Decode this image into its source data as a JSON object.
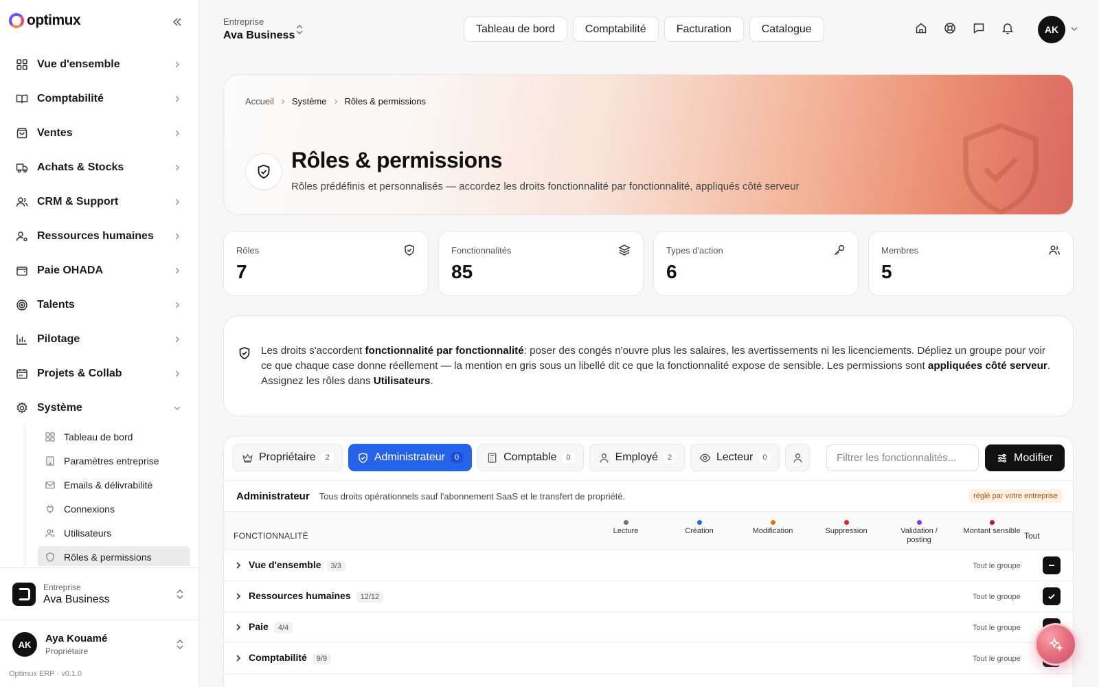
{
  "brand": {
    "name": "optimux"
  },
  "sidebar": {
    "items": [
      {
        "label": "Vue d'ensemble",
        "icon": "grid-icon"
      },
      {
        "label": "Comptabilité",
        "icon": "book-icon"
      },
      {
        "label": "Ventes",
        "icon": "shopping-bag-icon"
      },
      {
        "label": "Achats & Stocks",
        "icon": "truck-icon"
      },
      {
        "label": "CRM & Support",
        "icon": "users-icon"
      },
      {
        "label": "Ressources humaines",
        "icon": "user-cog-icon"
      },
      {
        "label": "Paie OHADA",
        "icon": "wallet-icon"
      },
      {
        "label": "Talents",
        "icon": "target-icon"
      },
      {
        "label": "Pilotage",
        "icon": "bar-chart-icon"
      },
      {
        "label": "Projets & Collab",
        "icon": "calendar-icon"
      },
      {
        "label": "Système",
        "icon": "gear-icon"
      }
    ],
    "system_sub": [
      {
        "label": "Tableau de bord",
        "icon": "grid-icon"
      },
      {
        "label": "Paramètres entreprise",
        "icon": "building-icon"
      },
      {
        "label": "Emails & délivrabilité",
        "icon": "mail-icon"
      },
      {
        "label": "Connexions",
        "icon": "plug-icon"
      },
      {
        "label": "Utilisateurs",
        "icon": "users-icon"
      },
      {
        "label": "Rôles & permissions",
        "icon": "shield-icon"
      }
    ],
    "company": {
      "label": "Entreprise",
      "name": "Ava Business"
    },
    "user": {
      "initials": "AK",
      "name": "Aya Kouamé",
      "role": "Propriétaire"
    },
    "version": "Optimux ERP · v0.1.0"
  },
  "topbar": {
    "entreprise_label": "Entreprise",
    "entreprise_name": "Ava Business",
    "tabs": [
      "Tableau de bord",
      "Comptabilité",
      "Facturation",
      "Catalogue"
    ],
    "icons": [
      "home-icon",
      "help-icon",
      "message-icon",
      "bell-icon"
    ],
    "avatar": "AK"
  },
  "hero": {
    "breadcrumb": [
      "Accueil",
      "Système",
      "Rôles & permissions"
    ],
    "title": "Rôles & permissions",
    "subtitle": "Rôles prédéfinis et personnalisés — accordez les droits fonctionnalité par fonctionnalité, appliqués côté serveur"
  },
  "stats": [
    {
      "label": "Rôles",
      "value": "7",
      "icon": "shield-icon"
    },
    {
      "label": "Fonctionnalités",
      "value": "85",
      "icon": "layers-icon"
    },
    {
      "label": "Types d'action",
      "value": "6",
      "icon": "key-icon"
    },
    {
      "label": "Membres",
      "value": "5",
      "icon": "users-icon"
    }
  ],
  "info": {
    "t1": "Les droits s'accordent ",
    "b1": "fonctionnalité par fonctionnalité",
    "t2": ": poser des congés n'ouvre plus les salaires, les avertissements ni les licenciements. Dépliez un groupe pour voir ce que chaque case donne réellement — la mention en gris sous un libellé dit ce que la fonctionnalité expose de sensible. Les permissions sont ",
    "b2": "appliquées côté serveur",
    "t3": ". Assignez les rôles dans ",
    "b3": "Utilisateurs",
    "t4": "."
  },
  "roles": {
    "tabs": [
      {
        "label": "Propriétaire",
        "count": "2",
        "icon": "crown-icon"
      },
      {
        "label": "Administrateur",
        "count": "0",
        "icon": "shield-icon"
      },
      {
        "label": "Comptable",
        "count": "0",
        "icon": "calculator-icon"
      },
      {
        "label": "Employé",
        "count": "2",
        "icon": "user-icon"
      },
      {
        "label": "Lecteur",
        "count": "0",
        "icon": "eye-icon"
      }
    ],
    "filter_placeholder": "Filtrer les fonctionnalités...",
    "modify_label": "Modifier",
    "selected": {
      "name": "Administrateur",
      "description": "Tous droits opérationnels sauf l'abonnement SaaS et le transfert de propriété.",
      "badge": "réglé par votre entreprise"
    }
  },
  "table": {
    "feature_header": "FONCTIONNALITÉ",
    "all_header": "Tout",
    "columns": [
      {
        "label1": "Lecture",
        "label2": "",
        "color": "#6b7280"
      },
      {
        "label1": "Création",
        "label2": "",
        "color": "#2563eb"
      },
      {
        "label1": "Modification",
        "label2": "",
        "color": "#d97706"
      },
      {
        "label1": "Suppression",
        "label2": "",
        "color": "#dc2626"
      },
      {
        "label1": "Validation /",
        "label2": "posting",
        "color": "#7c3aed"
      },
      {
        "label1": "Montant sensible",
        "label2": "",
        "color": "#be123c"
      }
    ],
    "group_label": "Tout le groupe",
    "rows": [
      {
        "name": "Vue d'ensemble",
        "count": "3/3",
        "state": "partial"
      },
      {
        "name": "Ressources humaines",
        "count": "12/12",
        "state": "checked"
      },
      {
        "name": "Paie",
        "count": "4/4",
        "state": "checked"
      },
      {
        "name": "Comptabilité",
        "count": "9/9",
        "state": "checked"
      }
    ]
  },
  "accent": "#2563eb"
}
